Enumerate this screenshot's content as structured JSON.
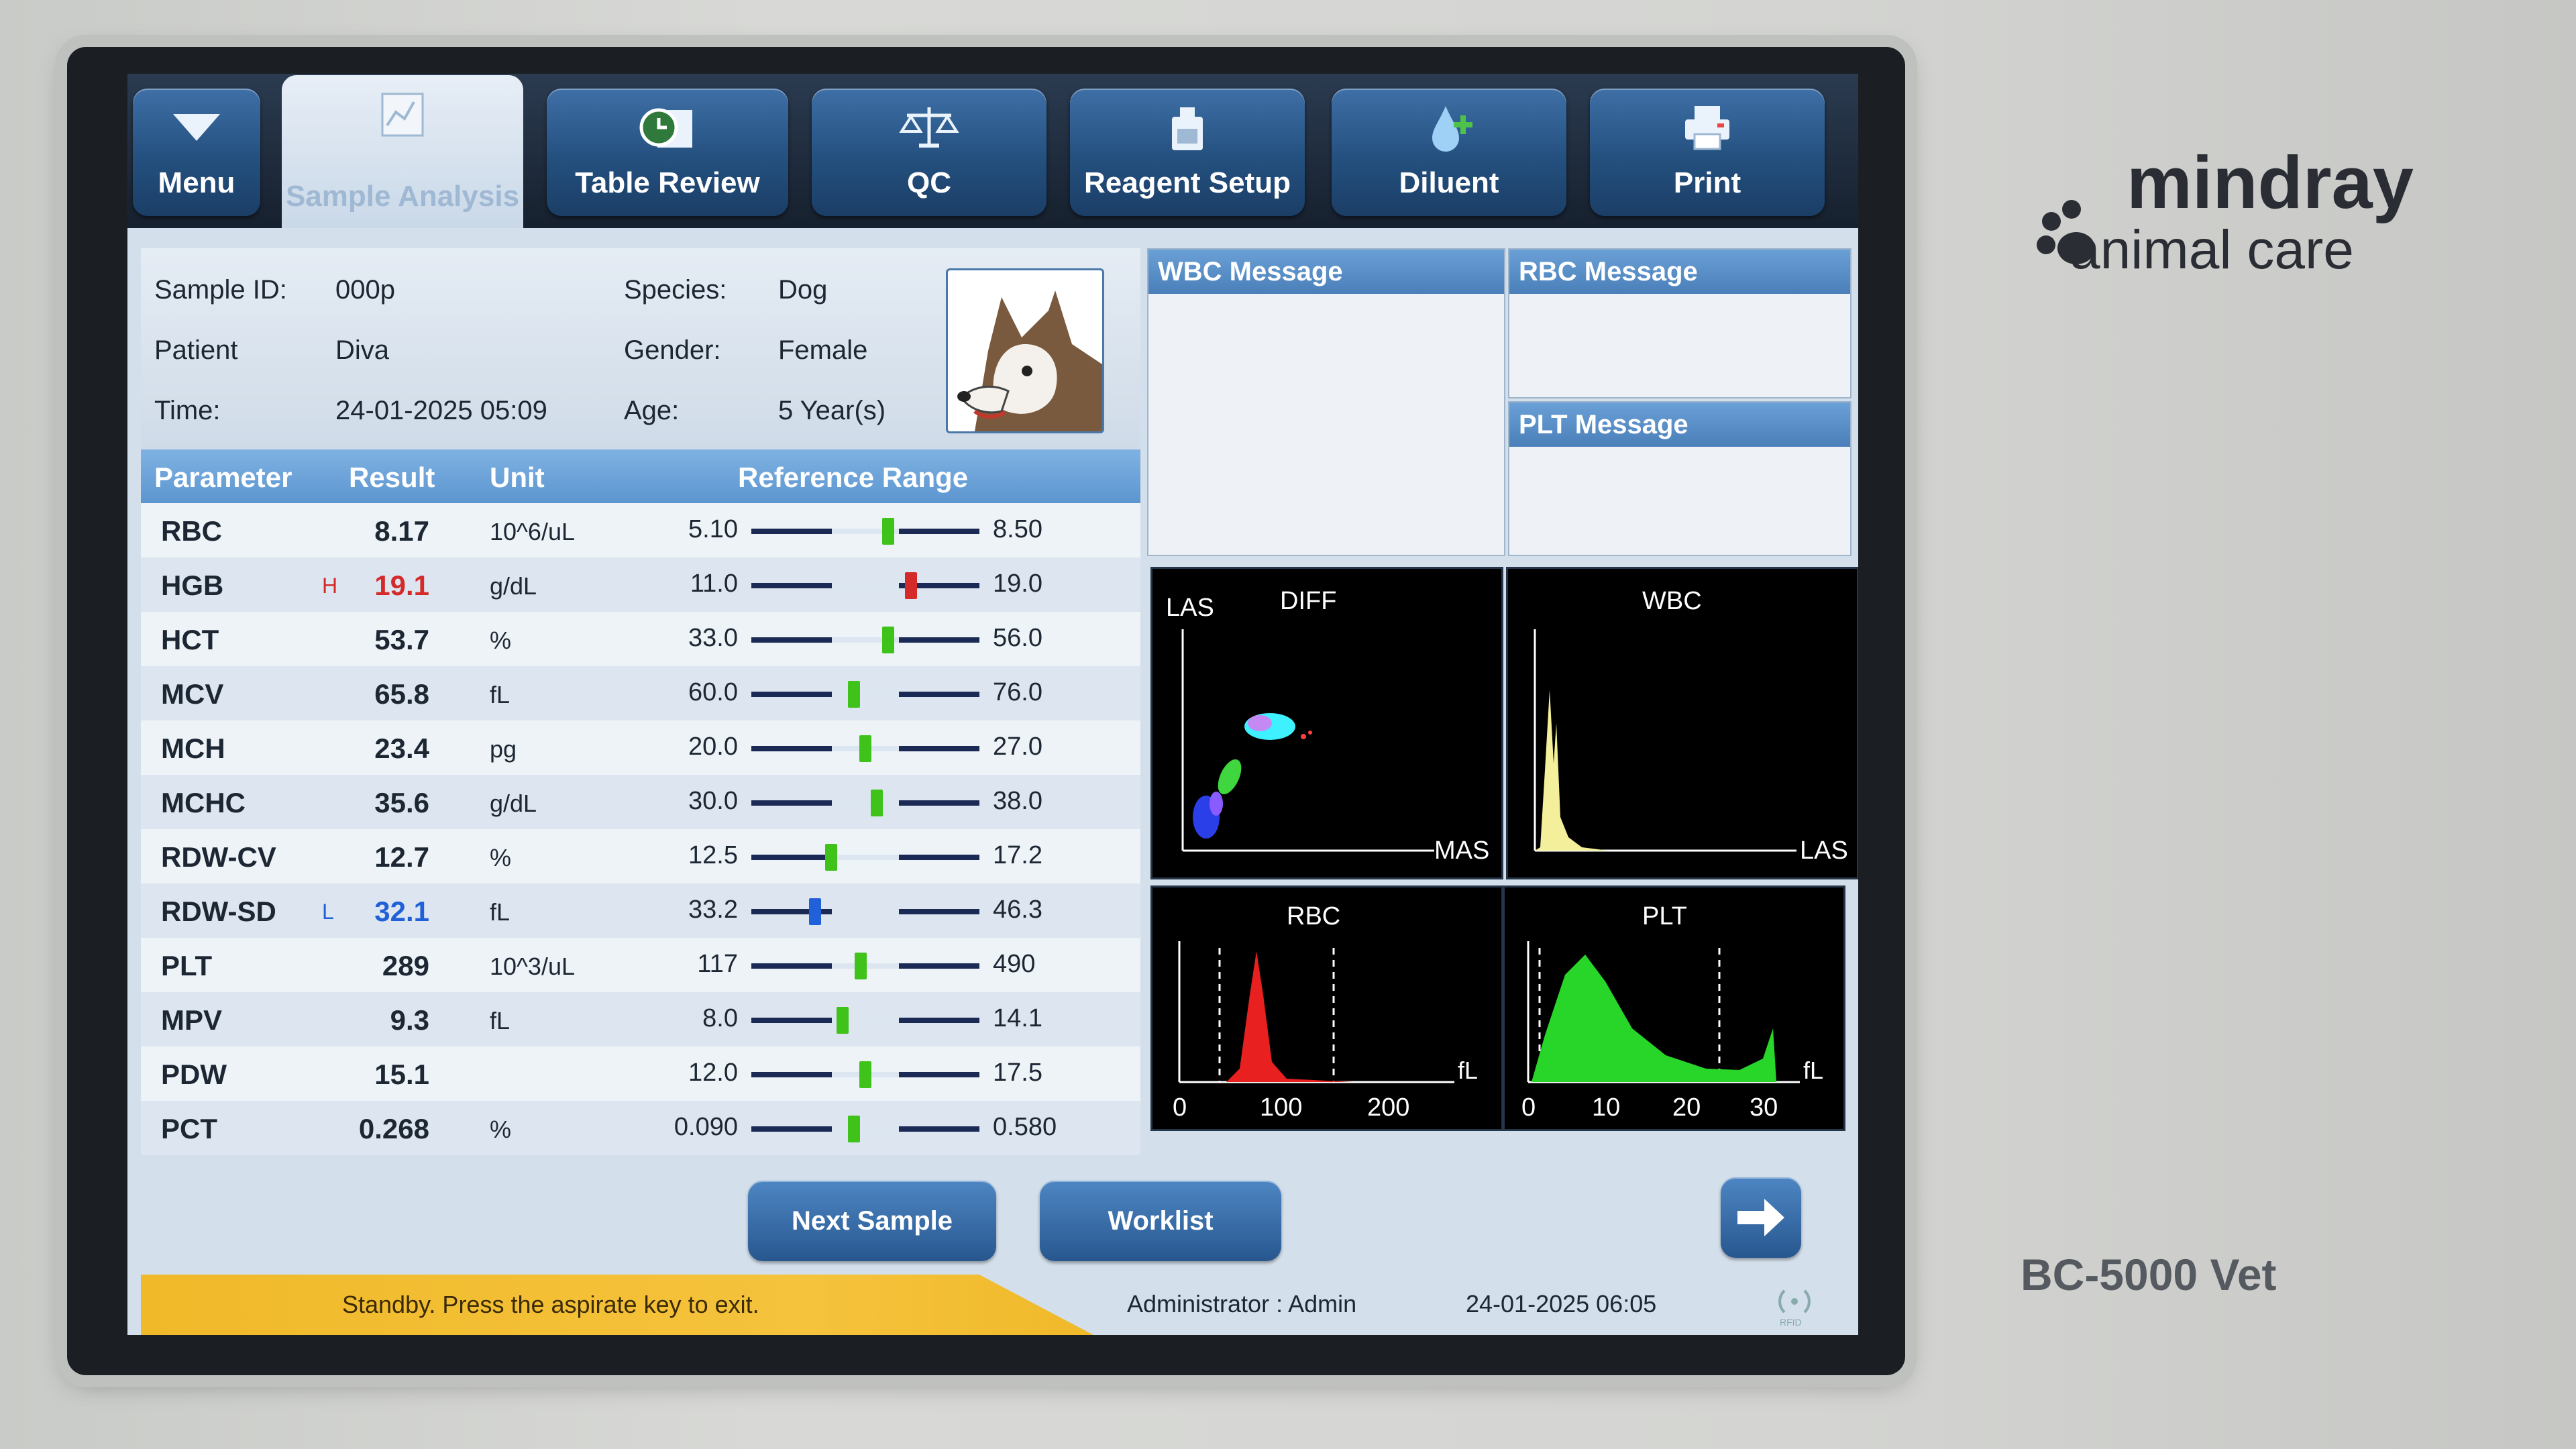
{
  "tabs": [
    {
      "label": "Menu",
      "icon": "menu-triangle-icon"
    },
    {
      "label": "Sample Analysis",
      "icon": "chart-icon",
      "active": true
    },
    {
      "label": "Table Review",
      "icon": "clock-table-icon"
    },
    {
      "label": "QC",
      "icon": "balance-scale-icon"
    },
    {
      "label": "Reagent Setup",
      "icon": "reagent-bottle-icon"
    },
    {
      "label": "Diluent",
      "icon": "diluent-drop-icon"
    },
    {
      "label": "Print",
      "icon": "printer-icon"
    }
  ],
  "sample": {
    "id_label": "Sample ID:",
    "id": "000p",
    "patient_label": "Patient",
    "patient": "Diva",
    "time_label": "Time:",
    "time": "24-01-2025 05:09",
    "species_label": "Species:",
    "species": "Dog",
    "gender_label": "Gender:",
    "gender": "Female",
    "age_label": "Age:",
    "age": "5 Year(s)"
  },
  "table": {
    "headers": [
      "Parameter",
      "Result",
      "Unit",
      "Reference Range"
    ],
    "rows": [
      {
        "param": "RBC",
        "flag": "",
        "result": "8.17",
        "unit": "10^6/uL",
        "lo": "5.10",
        "hi": "8.50",
        "pos": 0.6,
        "status": "normal"
      },
      {
        "param": "HGB",
        "flag": "H",
        "result": "19.1",
        "unit": "g/dL",
        "lo": "11.0",
        "hi": "19.0",
        "pos": 0.7,
        "status": "high"
      },
      {
        "param": "HCT",
        "flag": "",
        "result": "53.7",
        "unit": "%",
        "lo": "33.0",
        "hi": "56.0",
        "pos": 0.6,
        "status": "normal"
      },
      {
        "param": "MCV",
        "flag": "",
        "result": "65.8",
        "unit": "fL",
        "lo": "60.0",
        "hi": "76.0",
        "pos": 0.45,
        "status": "normal"
      },
      {
        "param": "MCH",
        "flag": "",
        "result": "23.4",
        "unit": "pg",
        "lo": "20.0",
        "hi": "27.0",
        "pos": 0.5,
        "status": "normal"
      },
      {
        "param": "MCHC",
        "flag": "",
        "result": "35.6",
        "unit": "g/dL",
        "lo": "30.0",
        "hi": "38.0",
        "pos": 0.55,
        "status": "normal"
      },
      {
        "param": "RDW-CV",
        "flag": "",
        "result": "12.7",
        "unit": "%",
        "lo": "12.5",
        "hi": "17.2",
        "pos": 0.35,
        "status": "normal"
      },
      {
        "param": "RDW-SD",
        "flag": "L",
        "result": "32.1",
        "unit": "fL",
        "lo": "33.2",
        "hi": "46.3",
        "pos": 0.28,
        "status": "low"
      },
      {
        "param": "PLT",
        "flag": "",
        "result": "289",
        "unit": "10^3/uL",
        "lo": "117",
        "hi": "490",
        "pos": 0.48,
        "status": "normal"
      },
      {
        "param": "MPV",
        "flag": "",
        "result": "9.3",
        "unit": "fL",
        "lo": "8.0",
        "hi": "14.1",
        "pos": 0.4,
        "status": "normal"
      },
      {
        "param": "PDW",
        "flag": "",
        "result": "15.1",
        "unit": "",
        "lo": "12.0",
        "hi": "17.5",
        "pos": 0.5,
        "status": "normal"
      },
      {
        "param": "PCT",
        "flag": "",
        "result": "0.268",
        "unit": "%",
        "lo": "0.090",
        "hi": "0.580",
        "pos": 0.45,
        "status": "normal"
      }
    ]
  },
  "messages": {
    "wbc": "WBC Message",
    "rbc": "RBC Message",
    "plt": "PLT Message"
  },
  "plots": {
    "diff": {
      "title": "DIFF",
      "ylabel": "LAS",
      "xlabel": "MAS"
    },
    "wbc": {
      "title": "WBC",
      "xlabel": "LAS"
    },
    "rbc": {
      "title": "RBC",
      "unit": "fL",
      "ticks": [
        "0",
        "100",
        "200"
      ]
    },
    "plt": {
      "title": "PLT",
      "unit": "fL",
      "ticks": [
        "0",
        "10",
        "20",
        "30"
      ]
    }
  },
  "buttons": {
    "next": "Next Sample",
    "worklist": "Worklist"
  },
  "status": {
    "message": "Standby. Press the aspirate key to exit.",
    "user": "Administrator : Admin",
    "datetime": "24-01-2025 06:05",
    "rfid": "RFID"
  },
  "brand": {
    "line1": "mindray",
    "line2": "animal care",
    "model": "BC-5000 Vet"
  },
  "colors": {
    "normal": "#3fc21a",
    "high": "#d42a2a",
    "low": "#2060d8",
    "accent": "#24507f"
  }
}
